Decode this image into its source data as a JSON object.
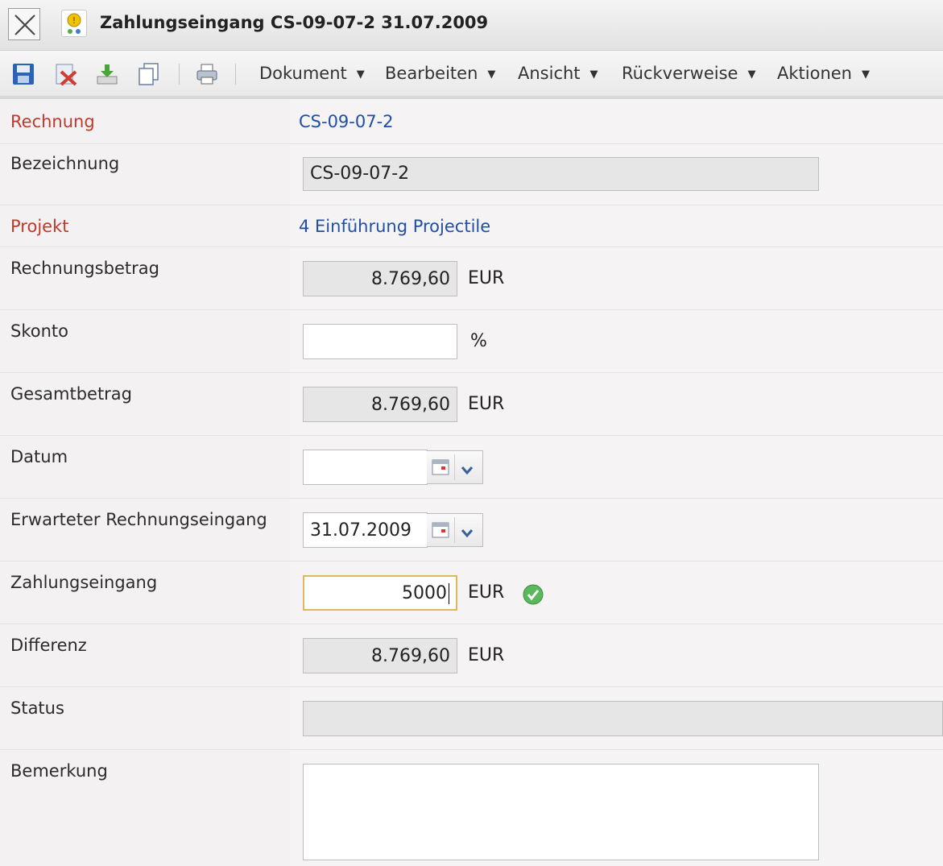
{
  "window": {
    "title": "Zahlungseingang CS-09-07-2 31.07.2009"
  },
  "toolbar": {
    "icons": [
      "save-icon",
      "delete-icon",
      "download-icon",
      "copy-icon",
      "print-icon"
    ],
    "menus": [
      "Dokument",
      "Bearbeiten",
      "Ansicht",
      "Rückverweise",
      "Aktionen"
    ],
    "arrow": "▼"
  },
  "form": {
    "rechnung": {
      "label": "Rechnung",
      "value": "CS-09-07-2"
    },
    "bezeichnung": {
      "label": "Bezeichnung",
      "value": "CS-09-07-2"
    },
    "projekt": {
      "label": "Projekt",
      "value": "4 Einführung Projectile"
    },
    "rechnungsbetrag": {
      "label": "Rechnungsbetrag",
      "value": "8.769,60",
      "unit": "EUR"
    },
    "skonto": {
      "label": "Skonto",
      "value": "",
      "unit": "%"
    },
    "gesamtbetrag": {
      "label": "Gesamtbetrag",
      "value": "8.769,60",
      "unit": "EUR"
    },
    "datum": {
      "label": "Datum",
      "value": ""
    },
    "erwarteter_rechnungseingang": {
      "label": "Erwarteter Rechnungseingang",
      "value": "31.07.2009"
    },
    "zahlungseingang": {
      "label": "Zahlungseingang",
      "value": "5000",
      "unit": "EUR"
    },
    "differenz": {
      "label": "Differenz",
      "value": "8.769,60",
      "unit": "EUR"
    },
    "status": {
      "label": "Status",
      "value": ""
    },
    "bemerkung": {
      "label": "Bemerkung",
      "value": ""
    }
  },
  "colors": {
    "required_label": "#c0392b",
    "link": "#1f4fa6",
    "valid_check": "#5cb85c"
  }
}
